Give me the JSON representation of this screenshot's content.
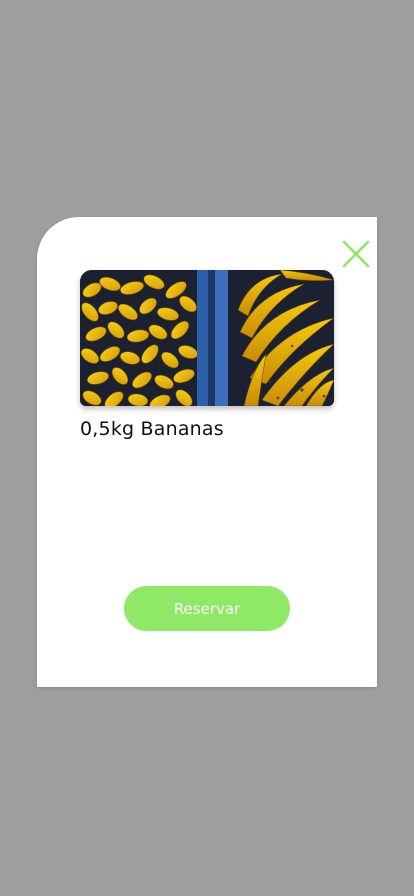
{
  "colors": {
    "backdrop": "#9e9e9d",
    "accent": "#8fe866",
    "card": "#ffffff",
    "text": "#111111"
  },
  "modal": {
    "close_icon": "close-x-icon",
    "product_image": "bananas-photo",
    "product_name": "0,5kg Bananas",
    "reserve_label": "Reservar"
  }
}
